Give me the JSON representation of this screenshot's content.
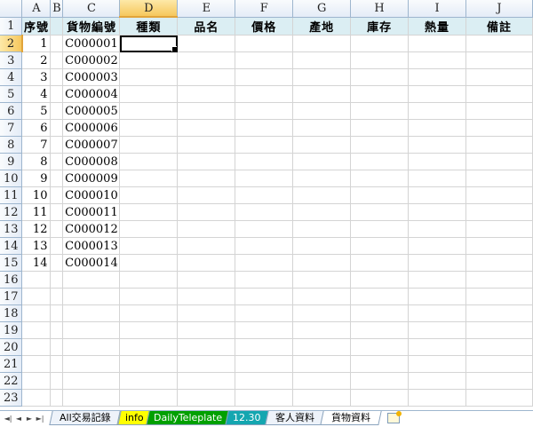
{
  "columns": [
    "A",
    "B",
    "C",
    "D",
    "E",
    "F",
    "G",
    "H",
    "I",
    "J"
  ],
  "header_row": [
    "序號",
    "",
    "貨物編號",
    "種類",
    "品名",
    "價格",
    "產地",
    "庫存",
    "熱量",
    "備註"
  ],
  "data_rows": [
    {
      "n": "1",
      "code": "C000001"
    },
    {
      "n": "2",
      "code": "C000002"
    },
    {
      "n": "3",
      "code": "C000003"
    },
    {
      "n": "4",
      "code": "C000004"
    },
    {
      "n": "5",
      "code": "C000005"
    },
    {
      "n": "6",
      "code": "C000006"
    },
    {
      "n": "7",
      "code": "C000007"
    },
    {
      "n": "8",
      "code": "C000008"
    },
    {
      "n": "9",
      "code": "C000009"
    },
    {
      "n": "10",
      "code": "C000010"
    },
    {
      "n": "11",
      "code": "C000011"
    },
    {
      "n": "12",
      "code": "C000012"
    },
    {
      "n": "13",
      "code": "C000013"
    },
    {
      "n": "14",
      "code": "C000014"
    }
  ],
  "row_numbers": [
    "1",
    "2",
    "3",
    "4",
    "5",
    "6",
    "7",
    "8",
    "9",
    "10",
    "11",
    "12",
    "13",
    "14",
    "15",
    "16",
    "17",
    "18",
    "19",
    "20",
    "21",
    "22",
    "23"
  ],
  "active_cell": "D2",
  "nav_buttons": [
    {
      "name": "first-sheet",
      "icon": "first-icon",
      "glyph": "◄|"
    },
    {
      "name": "prev-sheet",
      "icon": "prev-icon",
      "glyph": "◄"
    },
    {
      "name": "next-sheet",
      "icon": "next-icon",
      "glyph": "►"
    },
    {
      "name": "last-sheet",
      "icon": "last-icon",
      "glyph": "►|"
    }
  ],
  "sheet_tabs": [
    {
      "label": "All交易記錄",
      "style": "plain"
    },
    {
      "label": "info",
      "style": "yellow"
    },
    {
      "label": "DailyTeleplate",
      "style": "green"
    },
    {
      "label": "12.30",
      "style": "teal"
    },
    {
      "label": "客人資料",
      "style": "plain"
    },
    {
      "label": "貨物資料",
      "style": "active"
    }
  ],
  "colors": {
    "header_fill": "#dbeef3",
    "active_header": "#f6c75d",
    "tab_yellow": "#ffff00",
    "tab_green": "#00a000",
    "tab_teal": "#14a6b0"
  }
}
